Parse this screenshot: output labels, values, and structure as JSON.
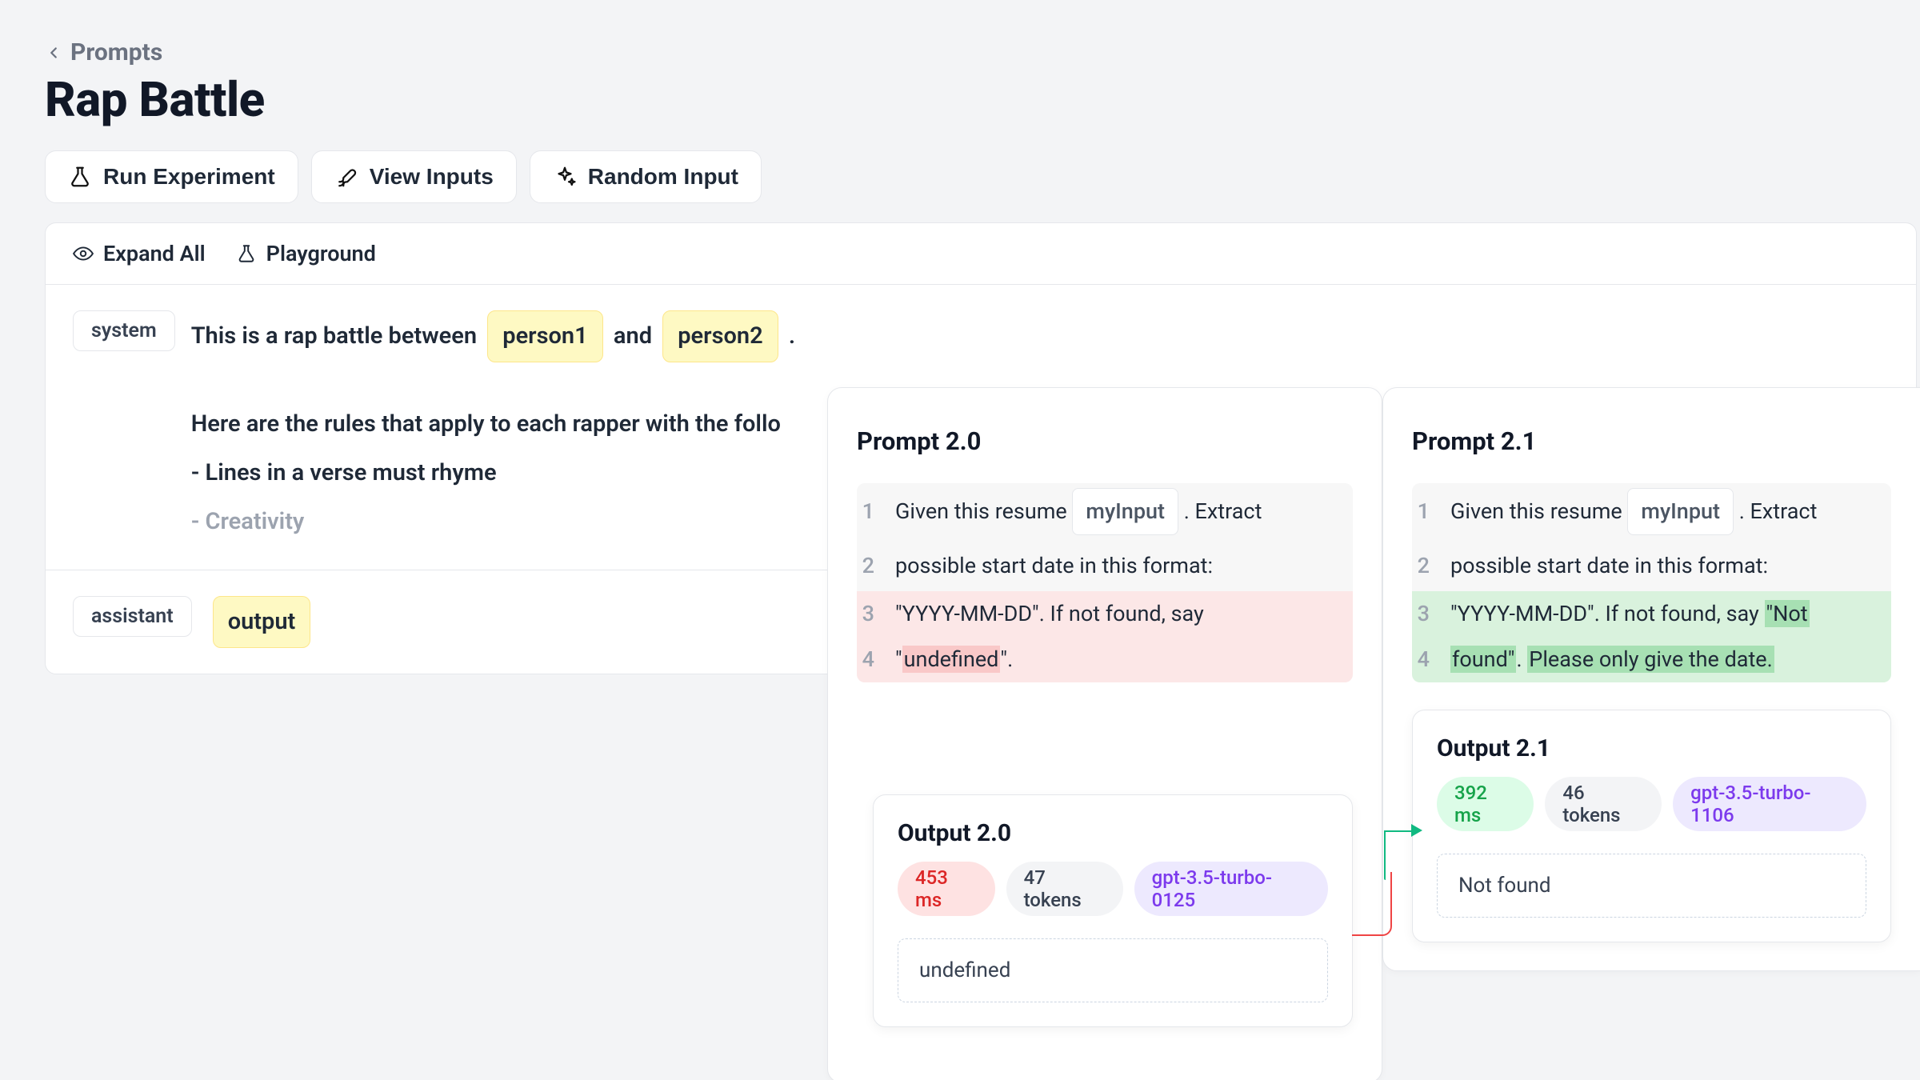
{
  "breadcrumb": {
    "label": "Prompts"
  },
  "page_title": "Rap Battle",
  "toolbar": {
    "run": "Run Experiment",
    "view_inputs": "View Inputs",
    "random_input": "Random Input"
  },
  "panel_actions": {
    "expand_all": "Expand All",
    "playground": "Playground"
  },
  "system_msg": {
    "role": "system",
    "intro_pre": "This is a rap battle between ",
    "var1": "person1",
    "mid": " and ",
    "var2": "person2",
    "post": ".",
    "rules_heading": "Here are the rules that apply to each rapper with the follo",
    "rule1": "- Lines in a verse must rhyme",
    "rule2": "- Creativity"
  },
  "assistant_msg": {
    "role": "assistant",
    "var": "output"
  },
  "prompts": {
    "left": {
      "title": "Prompt 2.0",
      "lines": [
        {
          "n": "1",
          "pre": "Given this resume ",
          "var": "myInput",
          "post": " . Extract",
          "kind": "neutral"
        },
        {
          "n": "2",
          "text": "possible start date in this format:",
          "kind": "neutral"
        },
        {
          "n": "3",
          "text": "\"YYYY-MM-DD\". If not found, say",
          "kind": "removed"
        },
        {
          "n": "4",
          "pre": "\"",
          "hl": "undefined",
          "post": "\".",
          "kind": "removed"
        }
      ]
    },
    "right": {
      "title": "Prompt 2.1",
      "lines": [
        {
          "n": "1",
          "pre": "Given this resume ",
          "var": "myInput",
          "post": " . Extract",
          "kind": "neutral"
        },
        {
          "n": "2",
          "text": "possible start date in this format:",
          "kind": "neutral"
        },
        {
          "n": "3",
          "pre": "\"YYYY-MM-DD\". If not found, say ",
          "hl": "\"Not",
          "kind": "added"
        },
        {
          "n": "4",
          "hl1": "found\"",
          "mid": ". ",
          "hl2": "Please only give the date.",
          "kind": "added"
        }
      ]
    }
  },
  "outputs": {
    "left": {
      "title": "Output 2.0",
      "time": "453 ms",
      "tokens": "47 tokens",
      "model": "gpt-3.5-turbo-0125",
      "result": "undefined"
    },
    "right": {
      "title": "Output 2.1",
      "time": "392 ms",
      "tokens": "46 tokens",
      "model": "gpt-3.5-turbo-1106",
      "result": "Not found"
    }
  }
}
